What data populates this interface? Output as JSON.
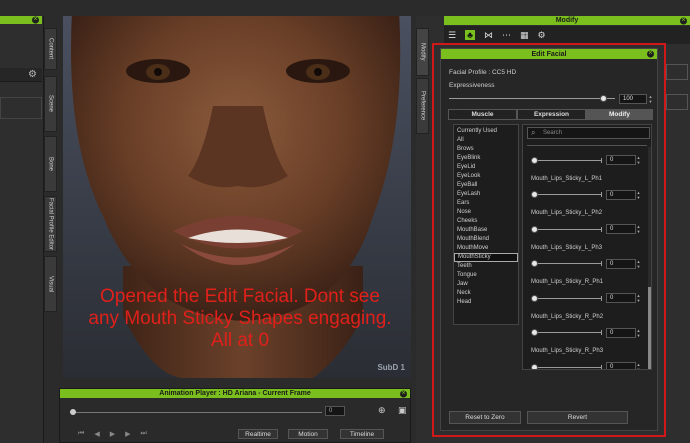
{
  "left_panel": {
    "tabs": [
      "Content",
      "Scene",
      "Bone",
      "Facial Profile Editor",
      "Visual"
    ]
  },
  "viewport": {
    "annotation": "Opened the Edit Facial. Dont see any Mouth Sticky Shapes engaging. All at 0",
    "watermark": "SubD 1"
  },
  "anim_player": {
    "title": "Animation Player : HD Ariana - Current Frame",
    "frame_value": "0",
    "buttons": [
      "Realtime",
      "Motion",
      "Timeline"
    ]
  },
  "modify_panel": {
    "title": "Modify",
    "side_tabs": [
      "Modify",
      "Preference"
    ],
    "toolbar_icons": [
      "sliders-icon",
      "figure-icon",
      "bone-icon",
      "morph-icon",
      "checker-icon",
      "gear-icon"
    ]
  },
  "edit_facial": {
    "title": "Edit Facial",
    "profile_label": "Facial Profile : CC5 HD",
    "expressiveness_label": "Expressiveness",
    "expressiveness_value": "100",
    "expressiveness_fraction": 0.93,
    "tabs": [
      "Muscle",
      "Expression",
      "Modify"
    ],
    "active_tab": 2,
    "search_placeholder": "Search",
    "categories": [
      "Currently Used",
      "All",
      "Brows",
      "EyeBlink",
      "EyeLid",
      "EyeLook",
      "EyeBall",
      "EyeLash",
      "Ears",
      "Nose",
      "Cheeks",
      "MouthBase",
      "MouthBlend",
      "MouthMove",
      "MouthSticky",
      "Teeth",
      "Tongue",
      "Jaw",
      "Neck",
      "Head"
    ],
    "selected_category": 14,
    "shapes": [
      {
        "label": "",
        "value": "0"
      },
      {
        "label": "Mouth_Lips_Sticky_L_Ph1",
        "value": "0"
      },
      {
        "label": "Mouth_Lips_Sticky_L_Ph2",
        "value": "0"
      },
      {
        "label": "Mouth_Lips_Sticky_L_Ph3",
        "value": "0"
      },
      {
        "label": "Mouth_Lips_Sticky_R_Ph1",
        "value": "0"
      },
      {
        "label": "Mouth_Lips_Sticky_R_Ph2",
        "value": "0"
      },
      {
        "label": "Mouth_Lips_Sticky_R_Ph3",
        "value": "0"
      }
    ],
    "reset_label": "Reset to Zero",
    "revert_label": "Revert"
  },
  "colors": {
    "accent_green": "#7bbf1f",
    "highlight_red": "#d01818",
    "annotation_red": "#e0201a"
  }
}
